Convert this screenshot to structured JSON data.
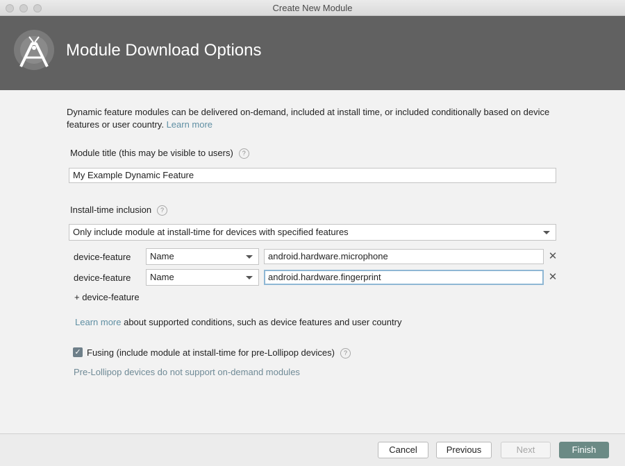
{
  "window": {
    "title": "Create New Module"
  },
  "header": {
    "title": "Module Download Options",
    "logo_icon": "android-studio-icon"
  },
  "description": {
    "text": "Dynamic feature modules can be delivered on-demand, included at install time, or included conditionally based on device features or user country.",
    "link": "Learn more"
  },
  "module_title": {
    "label": "Module title (this may be visible to users)",
    "value": "My Example Dynamic Feature"
  },
  "install_time": {
    "label": "Install-time inclusion",
    "selected": "Only include module at install-time for devices with specified features"
  },
  "conditions": [
    {
      "label": "device-feature",
      "type": "Name",
      "value": "android.hardware.microphone"
    },
    {
      "label": "device-feature",
      "type": "Name",
      "value": "android.hardware.fingerprint"
    }
  ],
  "add_condition": "+ device-feature",
  "conditions_help": {
    "link": "Learn more",
    "text": " about supported conditions, such as device features and user country"
  },
  "fusing": {
    "checked": true,
    "label": "Fusing (include module at install-time for pre-Lollipop devices)",
    "note": "Pre-Lollipop devices do not support on-demand modules"
  },
  "buttons": {
    "cancel": "Cancel",
    "previous": "Previous",
    "next": "Next",
    "finish": "Finish"
  },
  "help_glyph": "?",
  "remove_glyph": "✕",
  "check_glyph": "✓",
  "colors": {
    "header": "#616161",
    "link": "#5f8fa3",
    "finish": "#6b8a85",
    "checkbox": "#6e7f89"
  }
}
